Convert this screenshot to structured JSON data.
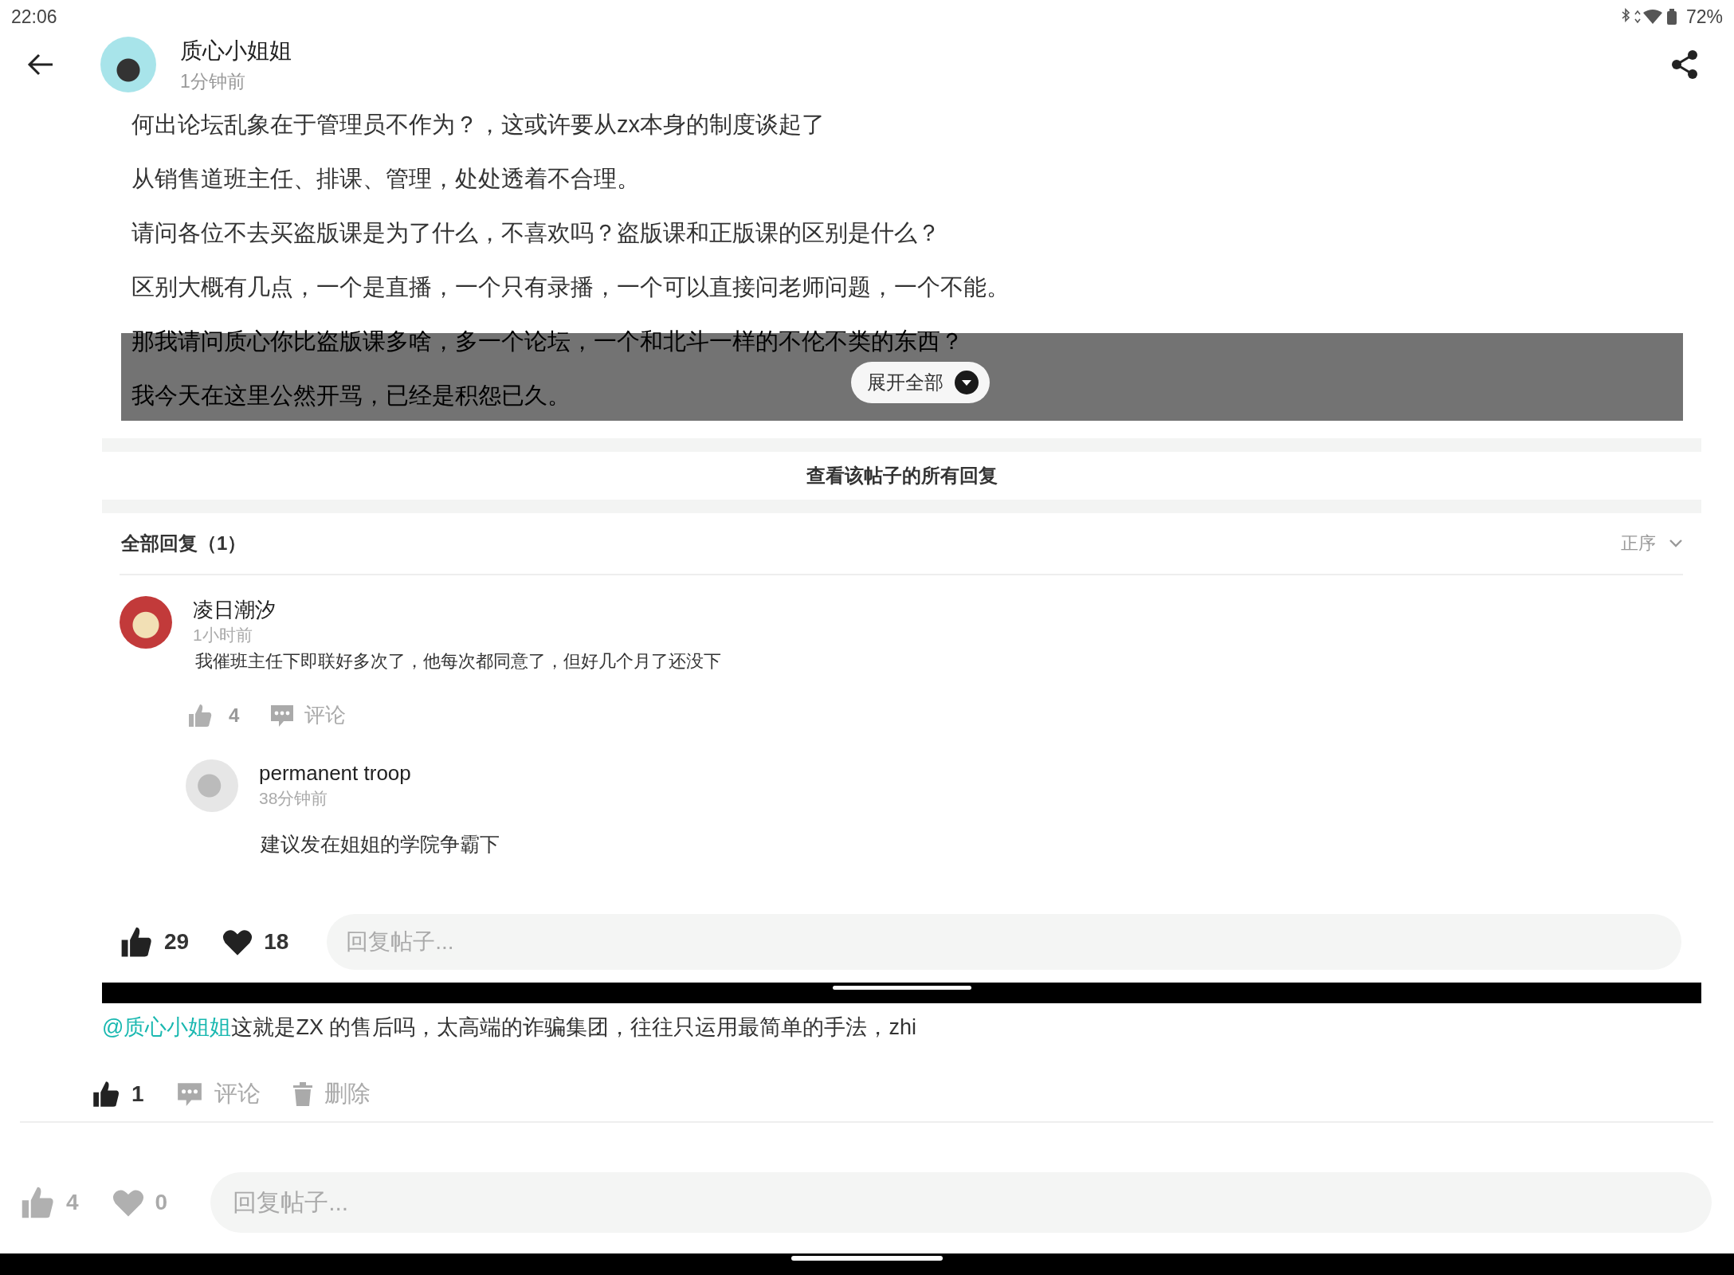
{
  "status_bar": {
    "time": "22:06",
    "battery": "72%"
  },
  "header": {
    "author": "质心小姐姐",
    "time": "1分钟前"
  },
  "post": {
    "paragraphs": [
      "何出论坛乱象在于管理员不作为？，这或许要从zx本身的制度谈起了",
      "从销售道班主任、排课、管理，处处透着不合理。",
      "请问各位不去买盗版课是为了什么，不喜欢吗？盗版课和正版课的区别是什么？",
      "区别大概有几点，一个是直播，一个只有录播，一个可以直接问老师问题，一个不能。",
      "那我请问质心你比盗版课多啥，多一个论坛，一个和北斗一样的不伦不类的东西？",
      "我今天在这里公然开骂，已经是积怨已久。"
    ],
    "collapsed": true,
    "expand_button": "展开全部"
  },
  "view_all": "查看该帖子的所有回复",
  "replies": {
    "title": "全部回复（1）",
    "sort": "正序"
  },
  "comment": {
    "author": "凌日潮汐",
    "time": "1小时前",
    "text": "我催班主任下即联好多次了，他每次都同意了，但好几个月了还没下",
    "likes": "4",
    "liked": false,
    "comment_label": "评论",
    "sub_reply": {
      "author": "permanent troop",
      "time": "38分钟前",
      "text": "建议发在姐姐的学院争霸下"
    }
  },
  "inner_bar": {
    "likes": "29",
    "liked": true,
    "hearts": "18",
    "hearted": true,
    "placeholder": "回复帖子..."
  },
  "outer_comment": {
    "mention": "@质心小姐姐",
    "text": "这就是ZX 的售后吗，太高端的诈骗集团，往往只运用最简单的手法，zhi",
    "likes": "1",
    "liked": true,
    "comment_label": "评论",
    "delete_label": "删除"
  },
  "bottom_bar": {
    "likes": "4",
    "liked": false,
    "hearts": "0",
    "hearted": false,
    "placeholder": "回复帖子..."
  }
}
